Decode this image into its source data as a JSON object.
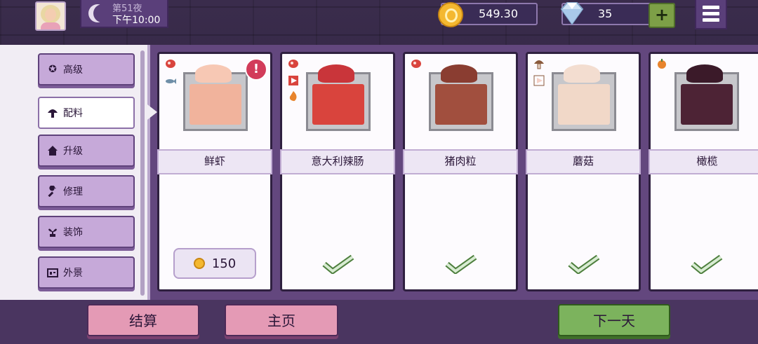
{
  "hud": {
    "night_label": "第51夜",
    "time_label": "下午10:00",
    "coins": "549.30",
    "gems": "35",
    "plus_label": "+"
  },
  "sidebar": {
    "tabs": [
      {
        "label": "高级",
        "icon": "badge-icon"
      },
      {
        "label": "配料",
        "icon": "mushroom-icon",
        "active": true
      },
      {
        "label": "升级",
        "icon": "home-icon"
      },
      {
        "label": "修理",
        "icon": "wrench-icon"
      },
      {
        "label": "装饰",
        "icon": "plant-icon"
      },
      {
        "label": "外景",
        "icon": "storefront-icon"
      }
    ]
  },
  "ingredients": [
    {
      "name": "鲜虾",
      "price": "150",
      "owned": false,
      "alert": "!",
      "colors": {
        "food": "#f1b39c",
        "heap": "#f7c8b4"
      }
    },
    {
      "name": "意大利辣肠",
      "owned": true,
      "colors": {
        "food": "#d9443d",
        "heap": "#c9353a"
      }
    },
    {
      "name": "猪肉粒",
      "owned": true,
      "colors": {
        "food": "#a14f3e",
        "heap": "#8a3d31"
      }
    },
    {
      "name": "蘑菇",
      "owned": true,
      "colors": {
        "food": "#f1d8c8",
        "heap": "#f3ddd0"
      }
    },
    {
      "name": "橄榄",
      "owned": true,
      "colors": {
        "food": "#4d2335",
        "heap": "#3b1a29"
      }
    }
  ],
  "buttons": {
    "checkout": "结算",
    "home": "主页",
    "next_day": "下一天"
  },
  "colors": {
    "panel": "#63477e",
    "tab": "#c6a9d9",
    "pink_button": "#e49ab5",
    "green_button": "#7cb35d",
    "check": "#6fa15a"
  }
}
